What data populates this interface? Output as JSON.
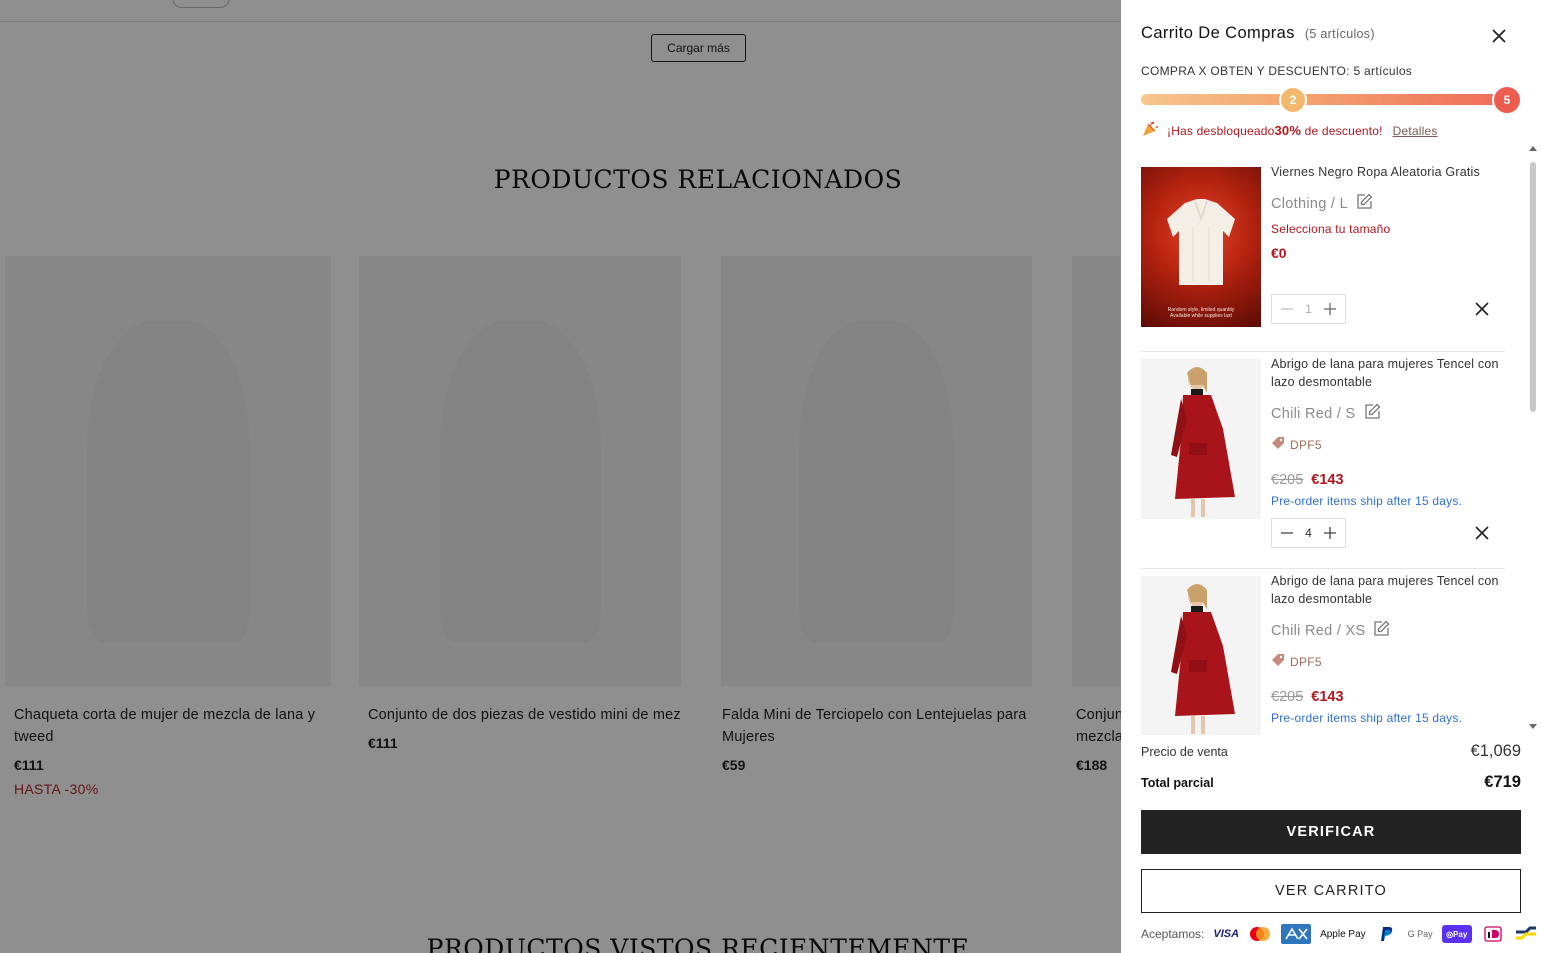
{
  "background": {
    "load_more_label": "Cargar más",
    "related_title": "PRODUCTOS RELACIONADOS",
    "recent_title": "PRODUCTOS VISTOS RECIENTEMENTE",
    "products": [
      {
        "name": "Chaqueta corta de mujer de mezcla de lana y tweed",
        "price": "€111",
        "badge": "HASTA -30%"
      },
      {
        "name": "Conjunto de dos piezas de vestido mini de mezcla de lana y tweed y parte superior…",
        "price": "€111",
        "badge": ""
      },
      {
        "name": "Falda Mini de Terciopelo con Lentejuelas para Mujeres",
        "price": "€59",
        "badge": ""
      },
      {
        "name": "Conjunto de dos piezas de vestido mini de mezcla de lana",
        "price": "€188",
        "badge": ""
      }
    ]
  },
  "cart": {
    "title": "Carrito De Compras",
    "count": "(5 artículos)",
    "promo_label": "COMPRA X OBTEN Y DESCUENTO: 5 artículos",
    "progress": {
      "milestones": [
        "2",
        "5"
      ],
      "fraction": 1.0
    },
    "unlock_prefix": "¡Has desbloqueado",
    "unlock_bold": "30%",
    "unlock_suffix": " de descuento!",
    "details_link": "Detalles",
    "items": [
      {
        "name": "Viernes Negro Ropa Aleatoria Gratis",
        "variant": "Clothing / L",
        "size_warning": "Selecciona tu tamaño",
        "price": "€0",
        "qty": "1",
        "thumb_caption": "Random style, limited quantity Available while supplies last"
      },
      {
        "name": "Abrigo de lana para mujeres Tencel con lazo desmontable",
        "variant": "Chili Red / S",
        "coupon": "DPF5",
        "old_price": "€205",
        "new_price": "€143",
        "preorder": "Pre-order items ship after 15 days.",
        "qty": "4"
      },
      {
        "name": "Abrigo de lana para mujeres Tencel con lazo desmontable",
        "variant": "Chili Red / XS",
        "coupon": "DPF5",
        "old_price": "€205",
        "new_price": "€143",
        "preorder": "Pre-order items ship after 15 days."
      }
    ],
    "sale_price_label": "Precio de venta",
    "sale_price_value": "€1,069",
    "subtotal_label": "Total parcial",
    "subtotal_value": "€719",
    "checkout_label": "VERIFICAR",
    "view_cart_label": "VER CARRITO",
    "accept_label": "Aceptamos:",
    "payment_methods": [
      "VISA",
      "Mastercard",
      "AMEX",
      "Apple Pay",
      "PayPal",
      "G Pay",
      "Shop Pay",
      "iDEAL",
      "Bancontact"
    ]
  },
  "colors": {
    "accent_red": "#b4161c",
    "link_blue": "#2f6fd6",
    "dark_button": "#222222",
    "progress_start": "#f6c68b",
    "progress_end": "#ee6a5a"
  }
}
